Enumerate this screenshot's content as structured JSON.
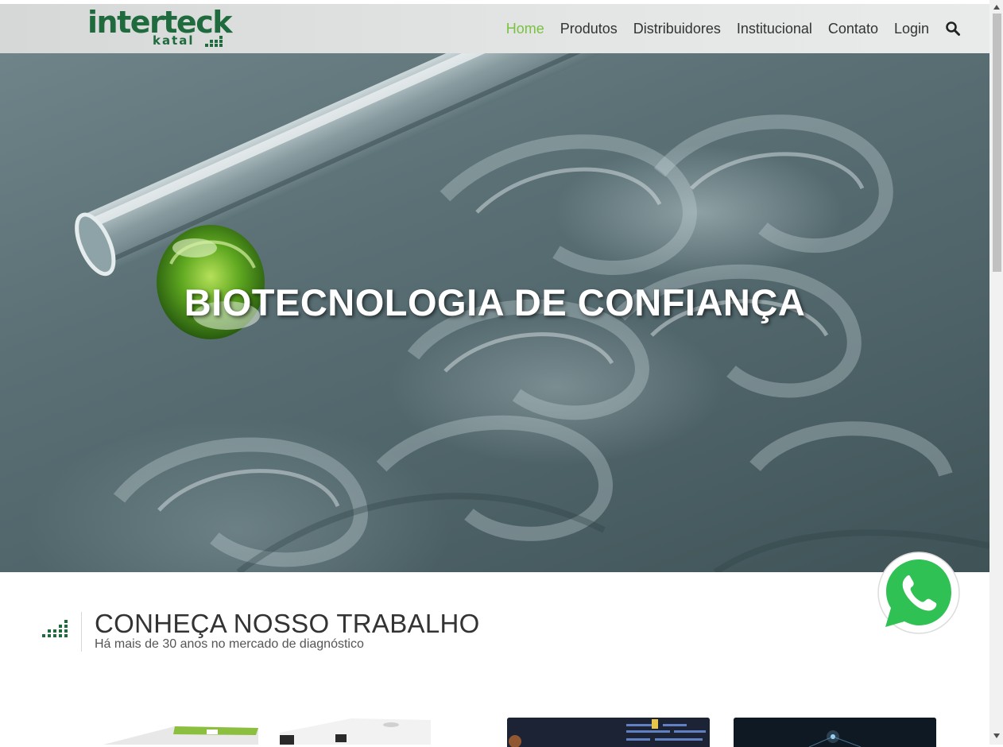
{
  "logo": {
    "word": "interteck",
    "sub": "katal"
  },
  "nav": {
    "items": [
      {
        "label": "Home",
        "active": true
      },
      {
        "label": "Produtos",
        "active": false
      },
      {
        "label": "Distribuidores",
        "active": false
      },
      {
        "label": "Institucional",
        "active": false
      },
      {
        "label": "Contato",
        "active": false
      },
      {
        "label": "Login",
        "active": false
      }
    ],
    "search_icon": "search-icon"
  },
  "hero": {
    "title": "BIOTECNOLOGIA DE CONFIANÇA"
  },
  "section": {
    "title": "CONHEÇA NOSSO TRABALHO",
    "subtitle": "Há mais de 30 anos no mercado de diagnóstico"
  },
  "colors": {
    "brand": "#1f6b3e",
    "accent": "#7ac142",
    "whatsapp": "#25d366"
  }
}
